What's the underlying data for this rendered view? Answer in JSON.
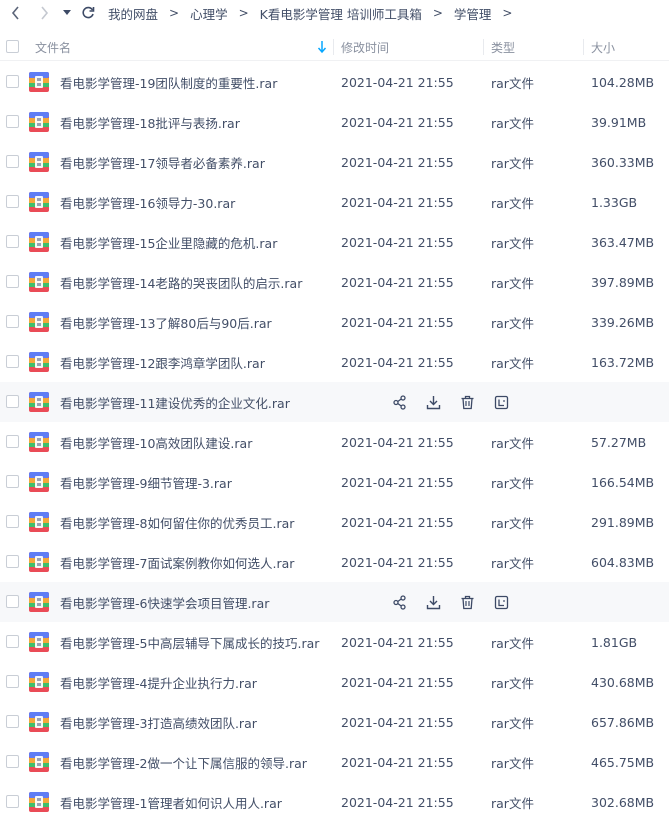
{
  "breadcrumb": [
    "我的网盘",
    "心理学",
    "K看电影学管理 培训师工具箱",
    "学管理"
  ],
  "breadcrumb_sep": ">",
  "columns": {
    "name": "文件名",
    "modified": "修改时间",
    "type": "类型",
    "size": "大小"
  },
  "files": [
    {
      "name": "看电影学管理-19团队制度的重要性.rar",
      "modified": "2021-04-21 21:55",
      "type": "rar文件",
      "size": "104.28MB",
      "hover": false
    },
    {
      "name": "看电影学管理-18批评与表扬.rar",
      "modified": "2021-04-21 21:55",
      "type": "rar文件",
      "size": "39.91MB",
      "hover": false
    },
    {
      "name": "看电影学管理-17领导者必备素养.rar",
      "modified": "2021-04-21 21:55",
      "type": "rar文件",
      "size": "360.33MB",
      "hover": false
    },
    {
      "name": "看电影学管理-16领导力-30.rar",
      "modified": "2021-04-21 21:55",
      "type": "rar文件",
      "size": "1.33GB",
      "hover": false
    },
    {
      "name": "看电影学管理-15企业里隐藏的危机.rar",
      "modified": "2021-04-21 21:55",
      "type": "rar文件",
      "size": "363.47MB",
      "hover": false
    },
    {
      "name": "看电影学管理-14老路的哭丧团队的启示.rar",
      "modified": "2021-04-21 21:55",
      "type": "rar文件",
      "size": "397.89MB",
      "hover": false
    },
    {
      "name": "看电影学管理-13了解80后与90后.rar",
      "modified": "2021-04-21 21:55",
      "type": "rar文件",
      "size": "339.26MB",
      "hover": false
    },
    {
      "name": "看电影学管理-12跟李鸿章学团队.rar",
      "modified": "2021-04-21 21:55",
      "type": "rar文件",
      "size": "163.72MB",
      "hover": false
    },
    {
      "name": "看电影学管理-11建设优秀的企业文化.rar",
      "modified": "",
      "type": "",
      "size": "",
      "hover": true
    },
    {
      "name": "看电影学管理-10高效团队建设.rar",
      "modified": "2021-04-21 21:55",
      "type": "rar文件",
      "size": "57.27MB",
      "hover": false
    },
    {
      "name": "看电影学管理-9细节管理-3.rar",
      "modified": "2021-04-21 21:55",
      "type": "rar文件",
      "size": "166.54MB",
      "hover": false
    },
    {
      "name": "看电影学管理-8如何留住你的优秀员工.rar",
      "modified": "2021-04-21 21:55",
      "type": "rar文件",
      "size": "291.89MB",
      "hover": false
    },
    {
      "name": "看电影学管理-7面试案例教你如何选人.rar",
      "modified": "2021-04-21 21:55",
      "type": "rar文件",
      "size": "604.83MB",
      "hover": false
    },
    {
      "name": "看电影学管理-6快速学会项目管理.rar",
      "modified": "",
      "type": "",
      "size": "",
      "hover": true
    },
    {
      "name": "看电影学管理-5中高层辅导下属成长的技巧.rar",
      "modified": "2021-04-21 21:55",
      "type": "rar文件",
      "size": "1.81GB",
      "hover": false
    },
    {
      "name": "看电影学管理-4提升企业执行力.rar",
      "modified": "2021-04-21 21:55",
      "type": "rar文件",
      "size": "430.68MB",
      "hover": false
    },
    {
      "name": "看电影学管理-3打造高绩效团队.rar",
      "modified": "2021-04-21 21:55",
      "type": "rar文件",
      "size": "657.86MB",
      "hover": false
    },
    {
      "name": "看电影学管理-2做一个让下属信服的领导.rar",
      "modified": "2021-04-21 21:55",
      "type": "rar文件",
      "size": "465.75MB",
      "hover": false
    },
    {
      "name": "看电影学管理-1管理者如何识人用人.rar",
      "modified": "2021-04-21 21:55",
      "type": "rar文件",
      "size": "302.68MB",
      "hover": false
    }
  ],
  "icons": {
    "file": "archive-file-icon",
    "share": "share-icon",
    "download": "download-icon",
    "delete": "trash-icon",
    "more": "more-icon"
  },
  "colors": {
    "accent": "#06a7ff",
    "text": "#424e67",
    "header_text": "#8a91a0",
    "hover_row": "#f7f8fa"
  }
}
